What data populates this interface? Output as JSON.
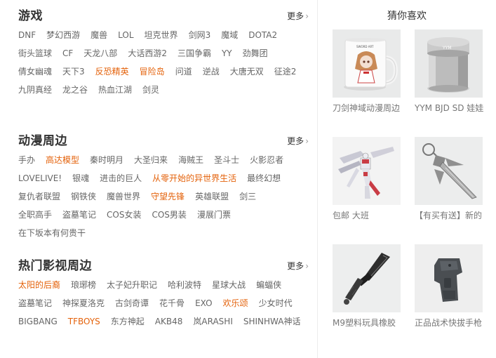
{
  "sections": [
    {
      "title": "游戏",
      "more": "更多",
      "rows": [
        [
          {
            "t": "DNF"
          },
          {
            "t": "梦幻西游"
          },
          {
            "t": "魔兽"
          },
          {
            "t": "LOL"
          },
          {
            "t": "坦克世界"
          },
          {
            "t": "剑网3"
          },
          {
            "t": "魔域"
          },
          {
            "t": "DOTA2"
          }
        ],
        [
          {
            "t": "街头篮球"
          },
          {
            "t": "CF"
          },
          {
            "t": "天龙八部"
          },
          {
            "t": "大话西游2"
          },
          {
            "t": "三国争霸"
          },
          {
            "t": "YY"
          },
          {
            "t": "劲舞团"
          }
        ],
        [
          {
            "t": "倩女幽魂"
          },
          {
            "t": "天下3"
          },
          {
            "t": "反恐精英",
            "hot": true
          },
          {
            "t": "冒险岛",
            "hot": true
          },
          {
            "t": "问道"
          },
          {
            "t": "逆战"
          },
          {
            "t": "大唐无双"
          },
          {
            "t": "征途2"
          }
        ],
        [
          {
            "t": "九阴真经"
          },
          {
            "t": "龙之谷"
          },
          {
            "t": "热血江湖"
          },
          {
            "t": "剑灵"
          }
        ]
      ]
    },
    {
      "title": "动漫周边",
      "more": "更多",
      "rows": [
        [
          {
            "t": "手办"
          },
          {
            "t": "高达模型",
            "hot": true
          },
          {
            "t": "秦时明月"
          },
          {
            "t": "大圣归来"
          },
          {
            "t": "海贼王"
          },
          {
            "t": "圣斗士"
          },
          {
            "t": "火影忍者"
          }
        ],
        [
          {
            "t": "LOVELIVE!"
          },
          {
            "t": "银魂"
          },
          {
            "t": "进击的巨人"
          },
          {
            "t": "从零开始的异世界生活",
            "hot": true
          },
          {
            "t": "最终幻想"
          }
        ],
        [
          {
            "t": "复仇者联盟"
          },
          {
            "t": "钢铁侠"
          },
          {
            "t": "魔兽世界"
          },
          {
            "t": "守望先锋",
            "hot": true
          },
          {
            "t": "英雄联盟"
          },
          {
            "t": "剑三"
          }
        ],
        [
          {
            "t": "全职高手"
          },
          {
            "t": "盗墓笔记"
          },
          {
            "t": "COS女装"
          },
          {
            "t": "COS男装"
          },
          {
            "t": "漫展门票"
          }
        ],
        [
          {
            "t": "在下坂本有何贵干"
          }
        ]
      ]
    },
    {
      "title": "热门影视周边",
      "more": "更多",
      "rows": [
        [
          {
            "t": "太阳的后裔",
            "hot": true
          },
          {
            "t": "琅琊榜"
          },
          {
            "t": "太子妃升职记"
          },
          {
            "t": "哈利波特"
          },
          {
            "t": "星球大战"
          },
          {
            "t": "蝙蝠侠"
          }
        ],
        [
          {
            "t": "盗墓笔记"
          },
          {
            "t": "神探夏洛克"
          },
          {
            "t": "古剑奇谭"
          },
          {
            "t": "花千骨"
          },
          {
            "t": "EXO"
          },
          {
            "t": "欢乐颂",
            "hot": true
          },
          {
            "t": "少女时代"
          }
        ],
        [
          {
            "t": "BIGBANG"
          },
          {
            "t": "TFBOYS",
            "hot": true
          },
          {
            "t": "东方神起"
          },
          {
            "t": "AKB48"
          },
          {
            "t": "岚ARASHI"
          },
          {
            "t": "SHINHWA神话"
          }
        ]
      ]
    }
  ],
  "guess": {
    "title": "猜你喜欢",
    "items": [
      {
        "caption": "刀剑神域动漫周边",
        "icon": "mug-image"
      },
      {
        "caption": "YYM BJD SD 娃娃",
        "icon": "tin-can-image",
        "label": "YYM"
      },
      {
        "caption": "包邮 大班",
        "icon": "gundam-model-image"
      },
      {
        "caption": "【有买有送】新的",
        "icon": "sword-keychain-image"
      },
      {
        "caption": "M9塑料玩具橡胶",
        "icon": "knife-image"
      },
      {
        "caption": "正品战术快拔手枪",
        "icon": "holster-image"
      }
    ]
  }
}
